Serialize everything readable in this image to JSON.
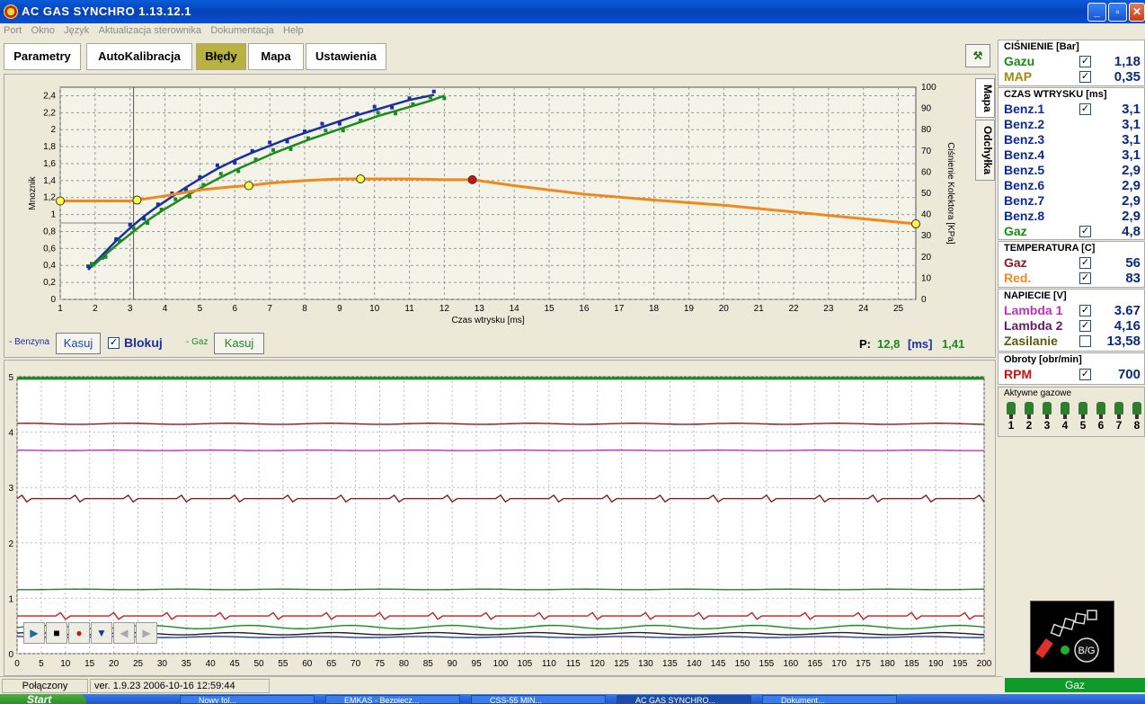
{
  "window": {
    "title": "AC GAS SYNCHRO    1.13.12.1",
    "minimize": "_",
    "maximize": "▫",
    "close": "✕"
  },
  "menu": [
    "Port",
    "Okno",
    "Język",
    "Aktualizacja sterownika",
    "Dokumentacja",
    "Help"
  ],
  "tabs": [
    {
      "label": "Parametry",
      "active": false
    },
    {
      "label": "AutoKalibracja",
      "active": false
    },
    {
      "label": "Błędy",
      "active": true
    },
    {
      "label": "Mapa",
      "active": false
    },
    {
      "label": "Ustawienia",
      "active": false
    }
  ],
  "side_tabs": [
    "Mapa",
    "Odchyłka"
  ],
  "controls": {
    "benzyna_label": "- Benzyna",
    "kasuj": "Kasuj",
    "blokuj": "Blokuj",
    "gaz_label": "- Gaz",
    "p_label": "P:",
    "p_value": "12,8",
    "p_unit": "[ms]",
    "p_mult": "1,41"
  },
  "chart_data": [
    {
      "type": "scatter",
      "xlabel": "Czas wtrysku [ms]",
      "ylabel": "Mnoznik",
      "y2label": "Ciśnienie Kolektora [KPa]",
      "xlim": [
        1,
        25.5
      ],
      "ylim": [
        0,
        2.5
      ],
      "y2lim": [
        0,
        100
      ],
      "xticks": [
        1,
        2,
        3,
        4,
        5,
        6,
        7,
        8,
        9,
        10,
        11,
        12,
        13,
        14,
        15,
        16,
        17,
        18,
        19,
        20,
        21,
        22,
        23,
        24,
        25
      ],
      "yticks": [
        "0",
        "0,2",
        "0,4",
        "0,6",
        "0,8",
        "1",
        "1,2",
        "1,4",
        "1,6",
        "1,8",
        "2",
        "2,2",
        "2,4"
      ],
      "y2ticks": [
        0,
        10,
        20,
        30,
        40,
        50,
        60,
        70,
        80,
        90,
        100
      ],
      "grid": true,
      "cursor_x": 3.1,
      "cursor_y": 0.9,
      "series": [
        {
          "color": "#1a2fa0",
          "x": [
            1.8,
            2.2,
            2.6,
            3.0,
            3.4,
            3.8,
            4.2,
            4.6,
            5.0,
            5.5,
            6.0,
            6.5,
            7.0,
            7.5,
            8.0,
            8.5,
            9.0,
            9.5,
            10.0,
            10.5,
            11.0,
            11.7
          ],
          "y": [
            0.35,
            0.52,
            0.69,
            0.84,
            0.98,
            1.1,
            1.21,
            1.32,
            1.42,
            1.54,
            1.64,
            1.73,
            1.81,
            1.89,
            1.96,
            2.03,
            2.1,
            2.17,
            2.23,
            2.29,
            2.35,
            2.41
          ]
        },
        {
          "color": "#1a8a20",
          "x": [
            1.9,
            2.3,
            2.7,
            3.1,
            3.5,
            3.9,
            4.3,
            4.7,
            5.1,
            5.6,
            6.1,
            6.6,
            7.1,
            7.6,
            8.1,
            8.6,
            9.1,
            9.6,
            10.1,
            10.6,
            11.1,
            11.6,
            12.0
          ],
          "y": [
            0.38,
            0.53,
            0.67,
            0.8,
            0.93,
            1.04,
            1.14,
            1.24,
            1.33,
            1.44,
            1.54,
            1.63,
            1.72,
            1.8,
            1.88,
            1.95,
            2.02,
            2.09,
            2.16,
            2.22,
            2.28,
            2.34,
            2.4
          ]
        },
        {
          "color": "#f0881e",
          "x": [
            1,
            2,
            3,
            3.2,
            4,
            5,
            6,
            6.4,
            7,
            8,
            9,
            9.6,
            10,
            11,
            12,
            12.8,
            14,
            16,
            18,
            20,
            22,
            24,
            25.5
          ],
          "y": [
            1.16,
            1.16,
            1.16,
            1.17,
            1.22,
            1.29,
            1.33,
            1.34,
            1.37,
            1.4,
            1.42,
            1.42,
            1.42,
            1.42,
            1.41,
            1.41,
            1.34,
            1.24,
            1.17,
            1.11,
            1.03,
            0.95,
            0.89
          ]
        }
      ],
      "markers": [
        {
          "x": 1,
          "y": 1.16,
          "color": "#ffff40"
        },
        {
          "x": 3.2,
          "y": 1.17,
          "color": "#ffff40"
        },
        {
          "x": 6.4,
          "y": 1.34,
          "color": "#ffff40"
        },
        {
          "x": 9.6,
          "y": 1.42,
          "color": "#ffff40"
        },
        {
          "x": 12.8,
          "y": 1.41,
          "color": "#d01010"
        },
        {
          "x": 25.5,
          "y": 0.89,
          "color": "#ffff40"
        }
      ]
    },
    {
      "type": "line",
      "xlim": [
        0,
        200
      ],
      "ylim": [
        0,
        5
      ],
      "xticks": [
        0,
        5,
        10,
        15,
        20,
        25,
        30,
        35,
        40,
        45,
        50,
        55,
        60,
        65,
        70,
        75,
        80,
        85,
        90,
        95,
        100,
        105,
        110,
        115,
        120,
        125,
        130,
        135,
        140,
        145,
        150,
        155,
        160,
        165,
        170,
        175,
        180,
        185,
        190,
        195,
        200
      ],
      "yticks": [
        0,
        1,
        2,
        3,
        4,
        5
      ],
      "grid": true,
      "series": [
        {
          "color": "#1a8a20",
          "level": 4.97,
          "ripple": 0
        },
        {
          "color": "#8b1a1a",
          "level": 4.15,
          "ripple": 0.01
        },
        {
          "color": "#c030c0",
          "level": 3.67,
          "ripple": 0.005
        },
        {
          "color": "#8b1a1a",
          "level": 2.8,
          "ripple": 0.06
        },
        {
          "color": "#2f7a2f",
          "level": 1.16,
          "ripple": 0.005
        },
        {
          "color": "#c02020",
          "level": 0.68,
          "ripple": 0.06
        },
        {
          "color": "#1a8a20",
          "level": 0.48,
          "ripple": 0.03
        },
        {
          "color": "#202020",
          "level": 0.36,
          "ripple": 0.02
        },
        {
          "color": "#2040a0",
          "level": 0.3,
          "ripple": 0.01
        }
      ]
    }
  ],
  "player": {
    "play": "▶",
    "stop": "■",
    "record": "●",
    "down": "▼",
    "prev": "◀",
    "next": "▶"
  },
  "right": {
    "cisnienie": {
      "title": "CIŚNIENIE [Bar]",
      "rows": [
        {
          "label": "Gazu",
          "value": "1,18",
          "color": "#158a15",
          "checked": true
        },
        {
          "label": "MAP",
          "value": "0,35",
          "color": "#a08a10",
          "checked": true
        }
      ]
    },
    "czas": {
      "title": "CZAS WTRYSKU  [ms]",
      "rows": [
        {
          "label": "Benz.1",
          "value": "3,1",
          "color": "#0d2a9a",
          "checked": true
        },
        {
          "label": "Benz.2",
          "value": "3,1",
          "color": "#0d2a9a",
          "checked": null
        },
        {
          "label": "Benz.3",
          "value": "3,1",
          "color": "#0d2a9a",
          "checked": null
        },
        {
          "label": "Benz.4",
          "value": "3,1",
          "color": "#0d2a9a",
          "checked": null
        },
        {
          "label": "Benz.5",
          "value": "2,9",
          "color": "#0d2a9a",
          "checked": null
        },
        {
          "label": "Benz.6",
          "value": "2,9",
          "color": "#0d2a9a",
          "checked": null
        },
        {
          "label": "Benz.7",
          "value": "2,9",
          "color": "#0d2a9a",
          "checked": null
        },
        {
          "label": "Benz.8",
          "value": "2,9",
          "color": "#0d2a9a",
          "checked": null
        },
        {
          "label": "Gaz",
          "value": "4,8",
          "color": "#158a15",
          "checked": true
        }
      ]
    },
    "temperatura": {
      "title": "TEMPERATURA  [C]",
      "rows": [
        {
          "label": "Gaz",
          "value": "56",
          "color": "#8b1a1a",
          "checked": true
        },
        {
          "label": "Red.",
          "value": "83",
          "color": "#f08a1e",
          "checked": true
        }
      ]
    },
    "napiecie": {
      "title": "NAPIECIE [V]",
      "rows": [
        {
          "label": "Lambda 1",
          "value": "3.67",
          "color": "#c030c0",
          "checked": true
        },
        {
          "label": "Lambda 2",
          "value": "4,16",
          "color": "#6a1a6a",
          "checked": true
        },
        {
          "label": "Zasilanie",
          "value": "13,58",
          "color": "#5a5a10",
          "checked": false
        }
      ]
    },
    "obroty": {
      "title": "Obroty [obr/min]",
      "rows": [
        {
          "label": "RPM",
          "value": "700",
          "color": "#d01010",
          "checked": true
        }
      ]
    },
    "aktywne": {
      "title": "Aktywne gazowe",
      "items": [
        "1",
        "2",
        "3",
        "4",
        "5",
        "6",
        "7",
        "8"
      ]
    },
    "switch_label": "B/G",
    "gaz_status": "Gaz"
  },
  "status": {
    "connection": "Połączony",
    "version": "ver. 1.9.23  2006-10-16  12:59:44"
  },
  "taskbar": {
    "start": "Start",
    "tasks": [
      "Nowy fol...",
      "EMKAS - Bezpiecz...",
      "CSS-55 MIN...",
      "AC GAS SYNCHRO...",
      "Dokument..."
    ]
  }
}
